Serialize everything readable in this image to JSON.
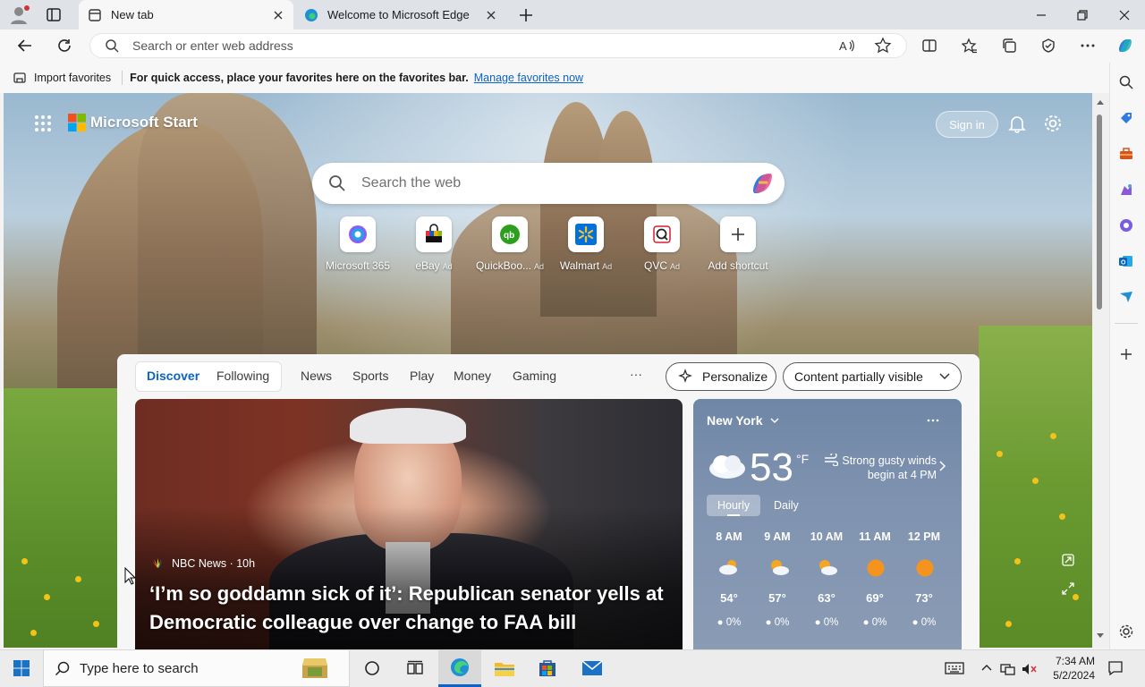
{
  "browser": {
    "tabs": [
      {
        "label": "New tab",
        "active": true,
        "icon": "new-tab-icon"
      },
      {
        "label": "Welcome to Microsoft Edge",
        "active": false,
        "icon": "edge-icon"
      }
    ],
    "address_placeholder": "Search or enter web address",
    "favorites_bar": {
      "import_label": "Import favorites",
      "message": "For quick access, place your favorites here on the favorites bar.",
      "manage_link": "Manage favorites now"
    }
  },
  "start": {
    "brand": "Microsoft Start",
    "sign_in": "Sign in",
    "search_placeholder": "Search the web",
    "shortcuts": [
      {
        "label": "Microsoft 365",
        "ad": false
      },
      {
        "label": "eBay",
        "ad": true
      },
      {
        "label": "QuickBoo...",
        "ad": true
      },
      {
        "label": "Walmart",
        "ad": true
      },
      {
        "label": "QVC",
        "ad": true
      },
      {
        "label": "Add shortcut",
        "ad": false
      }
    ],
    "ad_label": "Ad"
  },
  "feed": {
    "tabs": [
      "Discover",
      "Following"
    ],
    "categories": [
      "News",
      "Sports",
      "Play",
      "Money",
      "Gaming"
    ],
    "more": "···",
    "personalize": "Personalize",
    "content_visibility": "Content partially visible",
    "news": {
      "source": "NBC News · 10h",
      "headline": "‘I’m so goddamn sick of it’: Republican senator yells at Democratic colleague over change to FAA bill"
    },
    "weather": {
      "location": "New York",
      "temp": "53",
      "unit": "°F",
      "alert": "Strong gusty winds begin at 4 PM",
      "tabs": [
        "Hourly",
        "Daily"
      ],
      "hours": [
        {
          "time": "8 AM",
          "temp": "54°",
          "precip": "0%"
        },
        {
          "time": "9 AM",
          "temp": "57°",
          "precip": "0%"
        },
        {
          "time": "10 AM",
          "temp": "63°",
          "precip": "0%"
        },
        {
          "time": "11 AM",
          "temp": "69°",
          "precip": "0%"
        },
        {
          "time": "12 PM",
          "temp": "73°",
          "precip": "0%"
        }
      ]
    }
  },
  "taskbar": {
    "search_placeholder": "Type here to search",
    "time": "7:34 AM",
    "date": "5/2/2024"
  },
  "colors": {
    "accent": "#0b63c9",
    "discover": "#0b63c9"
  }
}
